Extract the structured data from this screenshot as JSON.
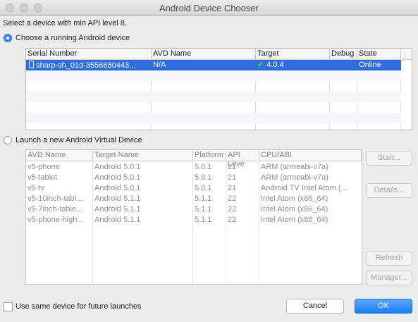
{
  "window": {
    "title": "Android Device Chooser"
  },
  "prompt": "Select a device with min API level 8.",
  "running_option": {
    "label": "Choose a running Android device",
    "selected": true
  },
  "device_table": {
    "headers": [
      "Serial Number",
      "AVD Name",
      "Target",
      "Debug",
      "State"
    ],
    "rows": [
      {
        "serial": "sharp-sh_01d-3556680443...",
        "avd": "N/A",
        "target": "4.0.4",
        "debug": "",
        "state": "Online",
        "selected": true
      }
    ]
  },
  "avd_option": {
    "label": "Launch a new Android Virtual Device",
    "selected": false
  },
  "avd_table": {
    "headers": [
      "AVD Name",
      "Target Name",
      "Platform",
      "API Leve",
      "CPU/ABI"
    ],
    "rows": [
      {
        "name": "v5-phone",
        "target": "Android 5.0.1",
        "platform": "5.0.1",
        "api": "21",
        "cpu": "ARM (armeabi-v7a)"
      },
      {
        "name": "v5-tablet",
        "target": "Android 5.0.1",
        "platform": "5.0.1",
        "api": "21",
        "cpu": "ARM (armeabi-v7a)"
      },
      {
        "name": "v5-tv",
        "target": "Android 5.0.1",
        "platform": "5.0.1",
        "api": "21",
        "cpu": "Android TV Intel Atom (..."
      },
      {
        "name": "v5-10inch-tabl...",
        "target": "Android 5.1.1",
        "platform": "5.1.1",
        "api": "22",
        "cpu": "Intel Atom (x86_64)"
      },
      {
        "name": "v5-7inch-table...",
        "target": "Android 5.1.1",
        "platform": "5.1.1",
        "api": "22",
        "cpu": "Intel Atom (x86_64)"
      },
      {
        "name": "v5-phone-high...",
        "target": "Android 5.1.1",
        "platform": "5.1.1",
        "api": "22",
        "cpu": "Intel Atom (x86_64)"
      }
    ]
  },
  "side_buttons": {
    "start": "Start...",
    "details": "Details...",
    "refresh": "Refresh",
    "manager": "Manager..."
  },
  "footer": {
    "same_device_label": "Use same device for future launches",
    "same_device_checked": false,
    "cancel": "Cancel",
    "ok": "OK"
  },
  "colors": {
    "selection": "#2f6de1",
    "primary_button": "#1b7cf5",
    "check": "#3fd23a"
  },
  "icons": {
    "device": "phone-icon",
    "target_ok": "checkmark-icon"
  }
}
